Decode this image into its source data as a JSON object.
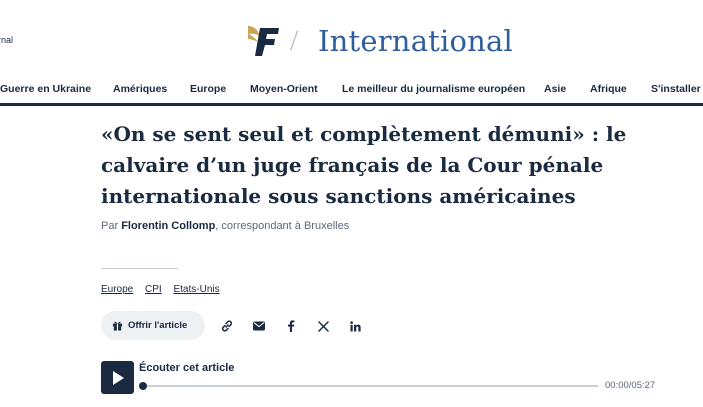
{
  "header": {
    "brand_fragment": "rnal",
    "separator": "/",
    "section_title": "International",
    "logo_icon": "le-figaro-f-logo",
    "logo_colors": {
      "letter": "#1a2a40",
      "feather": "#c9a552"
    }
  },
  "nav": {
    "items": [
      {
        "label": "Guerre en Ukraine"
      },
      {
        "label": "Amériques"
      },
      {
        "label": "Europe"
      },
      {
        "label": "Moyen-Orient"
      },
      {
        "label": "Le meilleur du journalisme européen"
      },
      {
        "label": "Asie"
      },
      {
        "label": "Afrique"
      },
      {
        "label": "S'installer à"
      }
    ]
  },
  "article": {
    "headline": "«On se sent seul et complètement démuni» : le calvaire d’un juge français de la Cour pénale internationale sous sanctions américaines",
    "byline_prefix": "Par",
    "author": "Florentin Collomp",
    "byline_suffix": ", correspondant à Bruxelles",
    "tags": [
      "Europe",
      "CPI",
      "Etats-Unis"
    ]
  },
  "actions": {
    "offer_label": "Offrir l'article",
    "offer_icon": "gift-icon",
    "share_icons": [
      "link-icon",
      "mail-icon",
      "facebook-icon",
      "x-icon",
      "linkedin-icon"
    ]
  },
  "audio": {
    "label": "Écouter cet article",
    "time": "00:00/05:27",
    "progress": 0
  },
  "colors": {
    "navy": "#1a2a40",
    "section_blue": "#2f5d9e",
    "muted": "#5c6878",
    "pill_bg": "#eef1f4"
  }
}
